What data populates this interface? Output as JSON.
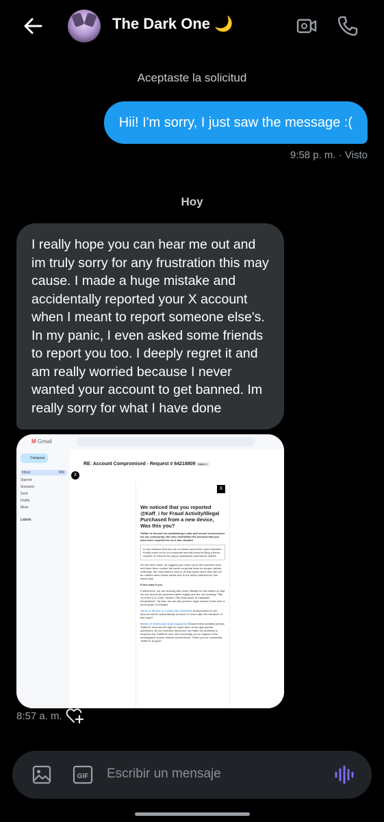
{
  "header": {
    "title": "The Dark One 🌙"
  },
  "system_message": "Aceptaste la solicitud",
  "outgoing": {
    "text": "Hii! I'm sorry, I just saw the message :(",
    "meta": "9:58 p. m. · Visto"
  },
  "day_separator": "Hoy",
  "incoming": {
    "text": "I really hope you can hear me out and im truly sorry for any frustration this may cause. I made a huge mistake and accidentally reported your X account when I meant to report someone else's. In my panic, I even asked some friends to report you too. I deeply regret it and am really worried because I never wanted your account to get banned. Im really sorry for what I have done",
    "image_time": "8:57 a. m."
  },
  "screenshot": {
    "app": "Gmail",
    "compose": "Compose",
    "nav": [
      {
        "label": "Inbox",
        "count": "999"
      },
      {
        "label": "Starred"
      },
      {
        "label": "Snoozed"
      },
      {
        "label": "Sent"
      },
      {
        "label": "Drafts"
      },
      {
        "label": "More"
      }
    ],
    "labels_heading": "Labels",
    "subject": "RE: Account Compromised - Request # 64218809",
    "subject_tag": "Inbox ×",
    "email_heading": "We noticed that you reported @Kaff_i for Fraud Activity/Illegal Purchased from a new device, Was this you?",
    "email_body_1": "Twitter is focused on maintaining a safe and secure environment for our community. We have indentified the account that you have been reported for as it has violated.",
    "email_box": "In any instance that you are not aware about this report activities. Kindly reach out to our corporate security head by filing a friend request on Discord for proper assistance (Username: kaffs0)",
    "email_body_2": "On the other hand, we suggest you reach out to the reported users and have them contact the same corporate team for proper identity matching. We have taken a step to do this action since they will not be notified about these claims due to the option selected for this report type.",
    "email_body_3": "If this wasn't you",
    "email_body_4": "Furthermore, we are working with some officials for this matter so that we can record all processes taken legally and are not violating \"Title 18 of the U.S Code, Section 798 (Disclosure of Classified Information)\". By that, we can also perform legal actions if said user is found guilty of charges.",
    "email_link_1": "Terms of Service or Community Guidelines",
    "email_body_5": "Authorization for the account will be automatically revoked 12 hours after the issuance of this report.",
    "email_link_2": "Breach of federal and state regulations",
    "email_body_6": "Should these activities persist, Twitter/X reserves the right to report them to the appropriate authorities. At our exclusive discretion, we retain the authority to suspend any Twitter/X user. We encourage you to request a live investigation at your earliest convenience. Thank you for contacting Twitter/X Support"
  },
  "composer": {
    "placeholder": "Escribir un mensaje"
  },
  "colors": {
    "accent": "#1d9bf0",
    "incoming_bubble": "#2f3336",
    "composer_bg": "#202327",
    "voice": "#7c6cf2"
  }
}
